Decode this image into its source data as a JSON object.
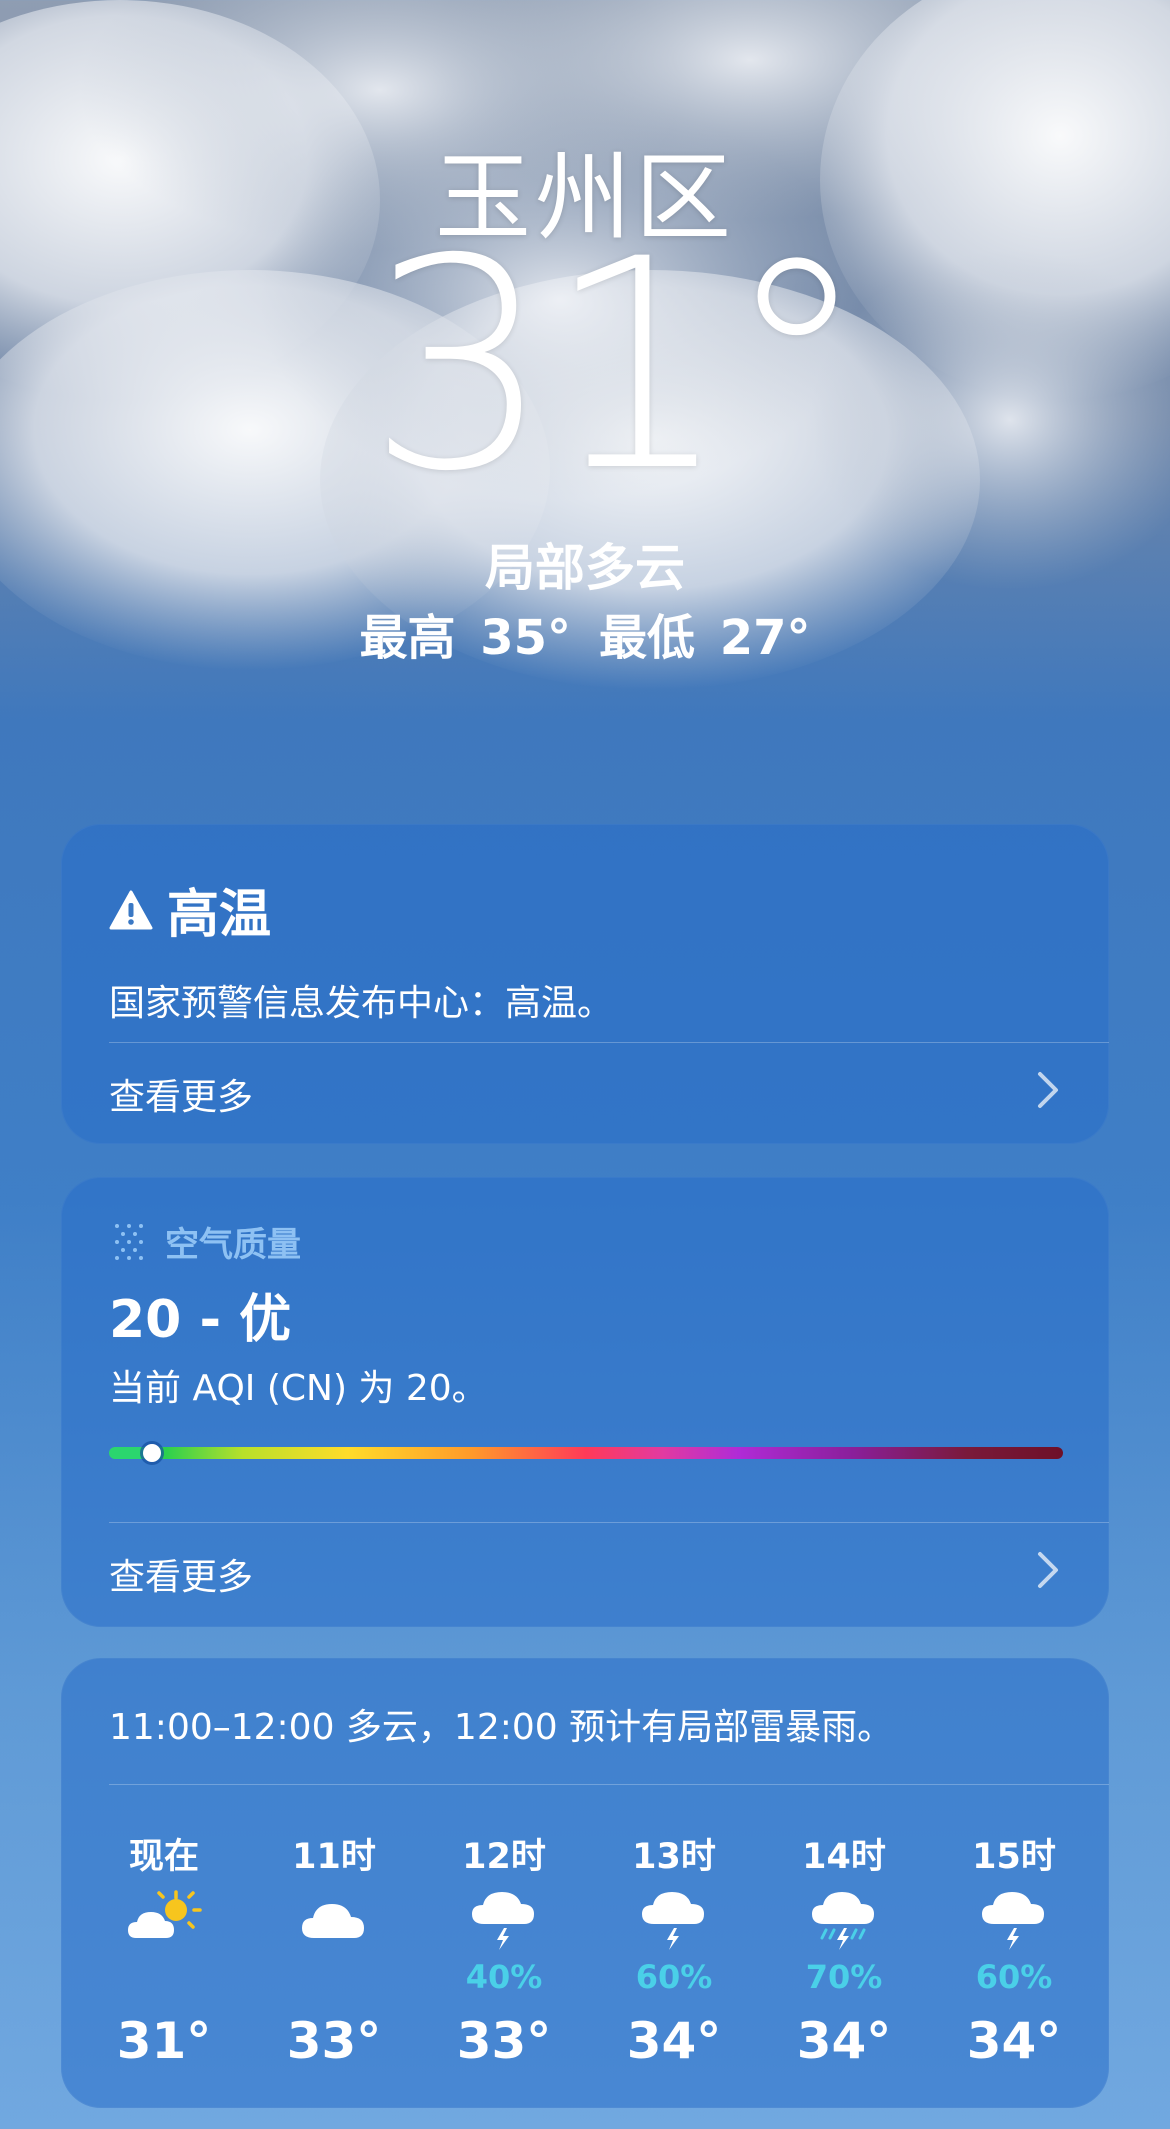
{
  "location": {
    "city": "玉州区",
    "temperature": "31°",
    "condition": "局部多云",
    "high": "最高 35°",
    "low": "最低 27°"
  },
  "alert": {
    "icon": "warning-triangle-icon",
    "title": "高温",
    "message": "国家预警信息发布中心：高温。",
    "more_label": "查看更多"
  },
  "air_quality": {
    "icon": "air-quality-dots-icon",
    "header": "空气质量",
    "value": "20 - 优",
    "description": "当前 AQI (CN) 为 20。",
    "scale_position": 0.045,
    "more_label": "查看更多"
  },
  "hourly": {
    "summary": "11:00–12:00 多云，12:00 预计有局部雷暴雨。",
    "hours": [
      {
        "label": "现在",
        "icon": "partly-sunny-icon",
        "pop": "",
        "temp": "31°"
      },
      {
        "label": "11时",
        "icon": "cloud-icon",
        "pop": "",
        "temp": "33°"
      },
      {
        "label": "12时",
        "icon": "thunderstorm-icon",
        "pop": "40%",
        "temp": "33°"
      },
      {
        "label": "13时",
        "icon": "thunderstorm-icon",
        "pop": "60%",
        "temp": "34°"
      },
      {
        "label": "14时",
        "icon": "heavy-thunderstorm-icon",
        "pop": "70%",
        "temp": "34°"
      },
      {
        "label": "15时",
        "icon": "thunderstorm-icon",
        "pop": "60%",
        "temp": "34°"
      }
    ]
  },
  "colors": {
    "card_bg": "#2f74c4",
    "pop": "#4ad0e8",
    "aqi_header": "#8ec1f3"
  }
}
